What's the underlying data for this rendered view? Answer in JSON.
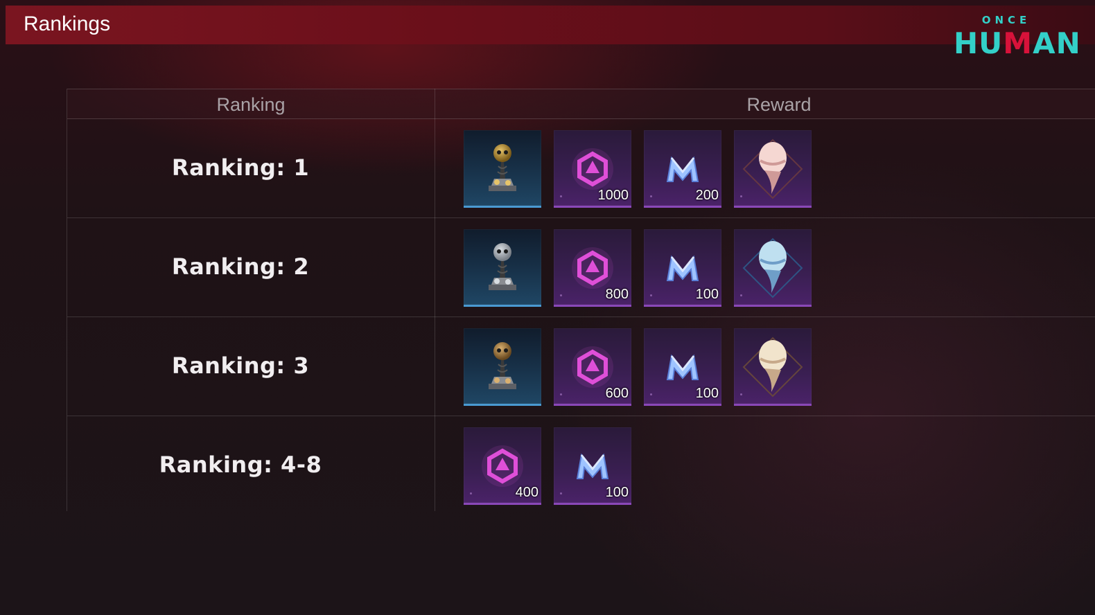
{
  "header": {
    "title": "Rankings"
  },
  "logo": {
    "top_text": "ONCE",
    "main_left": "HU",
    "main_m": "M",
    "main_right": "AN"
  },
  "table": {
    "headers": {
      "ranking": "Ranking",
      "reward": "Reward"
    },
    "rows": [
      {
        "label": "Ranking: 1",
        "rewards": [
          {
            "icon": "gold-skull-trophy-icon",
            "quantity": ""
          },
          {
            "icon": "hexagon-crystal-icon",
            "quantity": "1000"
          },
          {
            "icon": "starchrom-n-icon",
            "quantity": "200"
          },
          {
            "icon": "pink-helmet-emblem-icon",
            "quantity": ""
          }
        ]
      },
      {
        "label": "Ranking: 2",
        "rewards": [
          {
            "icon": "silver-skull-trophy-icon",
            "quantity": ""
          },
          {
            "icon": "hexagon-crystal-icon",
            "quantity": "800"
          },
          {
            "icon": "starchrom-n-icon",
            "quantity": "100"
          },
          {
            "icon": "blue-helmet-emblem-icon",
            "quantity": ""
          }
        ]
      },
      {
        "label": "Ranking: 3",
        "rewards": [
          {
            "icon": "bronze-skull-trophy-icon",
            "quantity": ""
          },
          {
            "icon": "hexagon-crystal-icon",
            "quantity": "600"
          },
          {
            "icon": "starchrom-n-icon",
            "quantity": "100"
          },
          {
            "icon": "cream-helmet-emblem-icon",
            "quantity": ""
          }
        ]
      },
      {
        "label": "Ranking: 4-8",
        "rewards": [
          {
            "icon": "hexagon-crystal-icon",
            "quantity": "400"
          },
          {
            "icon": "starchrom-n-icon",
            "quantity": "100"
          }
        ]
      }
    ]
  },
  "colors": {
    "header_bar": "#7a1520",
    "purple_item": "#3a1f52",
    "blue_item": "#18324a",
    "logo_teal": "#33d0c8",
    "logo_red": "#d8123a"
  }
}
